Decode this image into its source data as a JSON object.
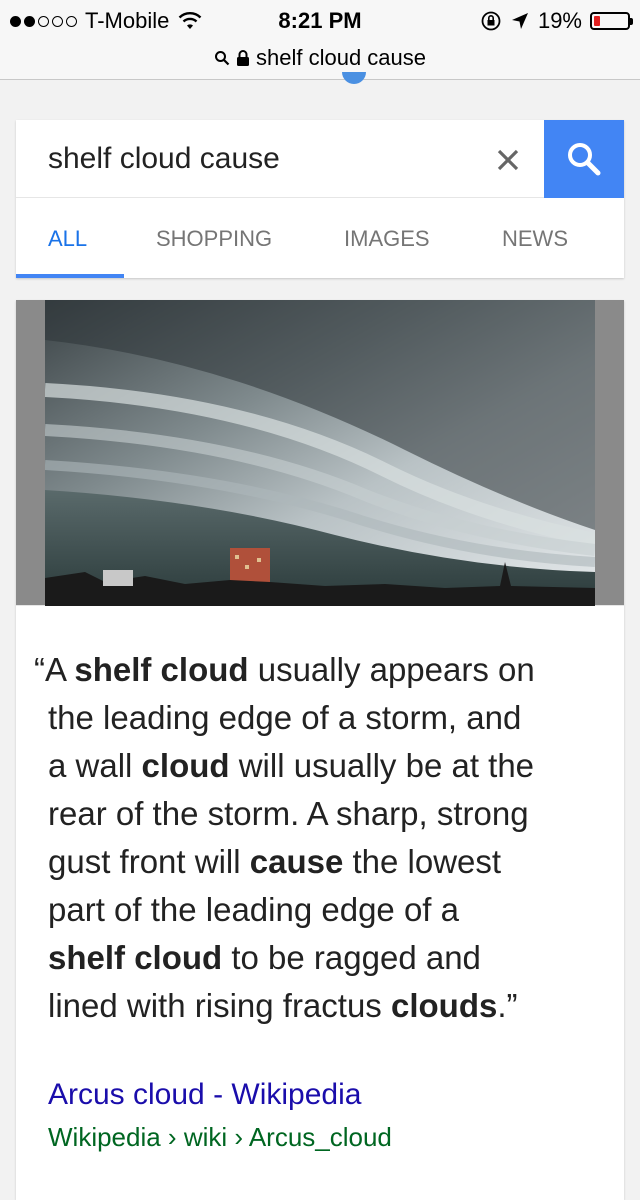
{
  "status_bar": {
    "carrier": "T-Mobile",
    "time": "8:21 PM",
    "battery": "19%",
    "battery_level": 0.19,
    "signal_bars_filled": 2,
    "signal_bars_total": 5
  },
  "url_bar": {
    "url": "shelf cloud cause"
  },
  "search": {
    "query": "shelf cloud cause",
    "clear_icon": "close-icon",
    "submit_icon": "search-icon"
  },
  "tabs": [
    {
      "label": "ALL",
      "active": true
    },
    {
      "label": "SHOPPING",
      "active": false
    },
    {
      "label": "IMAGES",
      "active": false
    },
    {
      "label": "NEWS",
      "active": false
    }
  ],
  "result": {
    "quote_lines": [
      [
        {
          "t": "“A ",
          "b": false
        },
        {
          "t": "shelf cloud",
          "b": true
        },
        {
          "t": " usually appears on",
          "b": false
        }
      ],
      [
        {
          "t": "the leading edge of a storm, and",
          "b": false
        }
      ],
      [
        {
          "t": "a wall ",
          "b": false
        },
        {
          "t": "cloud",
          "b": true
        },
        {
          "t": " will usually be at the",
          "b": false
        }
      ],
      [
        {
          "t": "rear of the storm. A sharp, strong",
          "b": false
        }
      ],
      [
        {
          "t": "gust front will ",
          "b": false
        },
        {
          "t": "cause",
          "b": true
        },
        {
          "t": " the lowest",
          "b": false
        }
      ],
      [
        {
          "t": "part of the leading edge of a",
          "b": false
        }
      ],
      [
        {
          "t": "shelf cloud",
          "b": true
        },
        {
          "t": " to be ragged and",
          "b": false
        }
      ],
      [
        {
          "t": "lined with rising fractus ",
          "b": false
        },
        {
          "t": "clouds",
          "b": true
        },
        {
          "t": ".”",
          "b": false
        }
      ]
    ],
    "link_title": "Arcus cloud - Wikipedia",
    "cite": "Wikipedia › wiki › Arcus_cloud"
  },
  "colors": {
    "accent": "#4285f4",
    "link": "#1a0dab",
    "cite": "#006621",
    "battery_low": "#e02020"
  }
}
